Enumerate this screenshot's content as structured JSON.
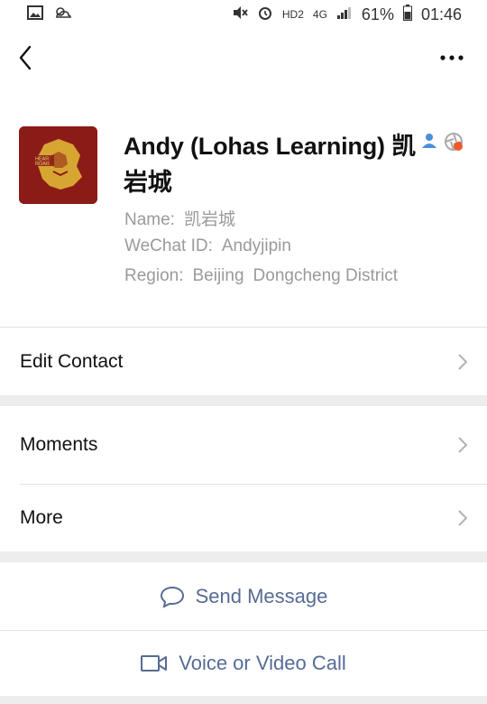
{
  "status_bar": {
    "battery": "61%",
    "time": "01:46",
    "network_label": "4G",
    "hd_label": "HD2"
  },
  "header": {
    "back_icon": "chevron-left-icon",
    "more_icon": "more-dots-icon"
  },
  "profile": {
    "display_name": "Andy (Lohas Learning) 凯岩城",
    "avatar_text": "HEAR ROAR",
    "name_label": "Name:",
    "name_value": "凯岩城",
    "wechat_label": "WeChat ID:",
    "wechat_value": "Andyjipin",
    "region_label": "Region:",
    "region_value1": "Beijing",
    "region_value2": "Dongcheng District",
    "colors": {
      "avatar_bg": "#8b1b17",
      "lion": "#d7a632"
    }
  },
  "menu": {
    "edit_contact": "Edit Contact",
    "moments": "Moments",
    "more": "More"
  },
  "actions": {
    "send_message": "Send Message",
    "voice_video": "Voice or Video Call"
  },
  "colors": {
    "link": "#576b95",
    "secondary_text": "#9a9a9a",
    "divider": "#e2e2e2",
    "gap": "#ededed"
  }
}
